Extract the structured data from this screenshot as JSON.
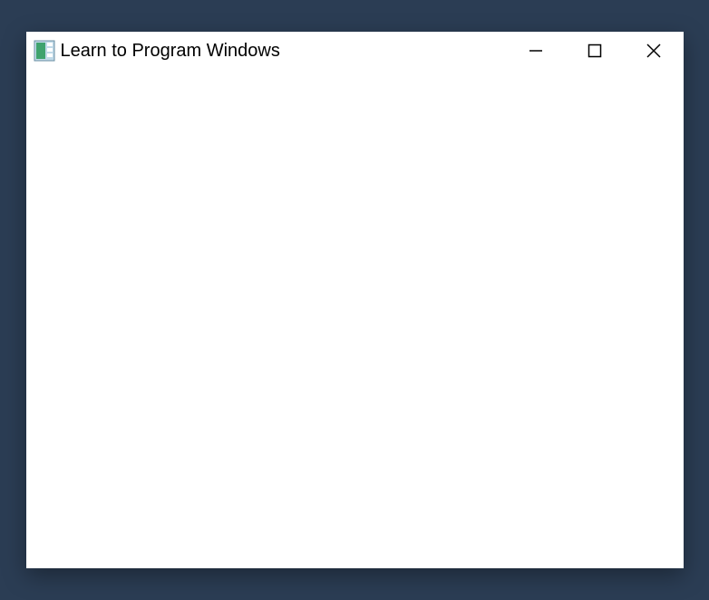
{
  "window": {
    "title": "Learn to Program Windows"
  }
}
